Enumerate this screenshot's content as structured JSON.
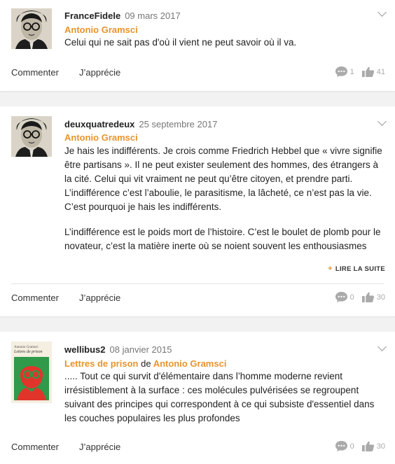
{
  "comments": [
    {
      "username": "FranceFidele",
      "date": "09 mars 2017",
      "source_author": "Antonio Gramsci",
      "quote": [
        "Celui qui ne sait pas d'où il vient ne peut savoir où il va."
      ],
      "comment_label": "Commenter",
      "like_label": "J’apprécie",
      "comment_count": "1",
      "like_count": "41",
      "avatar": "portrait-bw"
    },
    {
      "username": "deuxquatredeux",
      "date": "25 septembre 2017",
      "source_author": "Antonio Gramsci",
      "quote": [
        "Je hais les indifférents. Je crois comme Friedrich Hebbel que « vivre signifie être partisans ». Il ne peut exister seulement des hommes, des étrangers à la cité. Celui qui vit vraiment ne peut qu’être citoyen, et prendre parti. L’indifférence c’est l’aboulie, le parasitisme, la lâcheté, ce n’est pas la vie. C’est pourquoi je hais les indifférents.",
        "L’indifférence est le poids mort de l’histoire. C’est le boulet de plomb pour le novateur, c’est la matière inerte où se noient souvent les enthousiasmes"
      ],
      "read_more": "LIRE LA SUITE",
      "comment_label": "Commenter",
      "like_label": "J’apprécie",
      "comment_count": "0",
      "like_count": "30",
      "avatar": "portrait-bw"
    },
    {
      "username": "wellibus2",
      "date": "08 janvier 2015",
      "source_book": "Lettres de prison",
      "source_de": "de",
      "source_author": "Antonio Gramsci",
      "quote": [
        "..... Tout ce qui survit d'élémentaire dans l’homme moderne revient irrésistiblement à la surface : ces molécules pulvérisées se regroupent suivant des principes qui correspondent à ce qui subsiste d'essentiel dans les couches populaires les plus profondes"
      ],
      "comment_label": "Commenter",
      "like_label": "J’apprécie",
      "comment_count": "0",
      "like_count": "30",
      "avatar": "book-cover",
      "cover_author": "Antonio Gramsci",
      "cover_title": "Lettres de prison"
    }
  ],
  "colors": {
    "accent": "#e8942c",
    "icon_gray": "#aaaaaa",
    "cover_green": "#2e9a4a",
    "cover_red": "#e1352b"
  }
}
